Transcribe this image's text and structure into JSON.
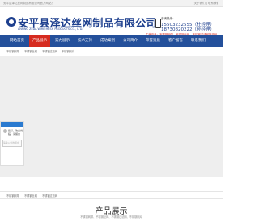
{
  "topbar": {
    "left_text": "安平县泽达丝网制品有限公司官方网站！",
    "right_text": "关于我们 | 联系我们"
  },
  "header": {
    "logo_cn": "安平县泽达丝网制品有限公司",
    "logo_en": "ANPING ZEDA WIRE MESH PRODUCTS CO., LTD.",
    "hotline_label": "咨询热线：",
    "hotline_1": "15503232555（杜经理）",
    "hotline_2": "18730820222（孙经理）",
    "slogan": "主营产品：不锈钢网带、不锈钢丝网、不锈钢过滤网等产品"
  },
  "nav": {
    "items": [
      "网站首页",
      "产品展示",
      "实力展示",
      "技术支持",
      "成功案例",
      "公司简介",
      "荣誉资质",
      "客户留言",
      "联系我们"
    ],
    "active_index": 1
  },
  "subbar": {
    "items": [
      "不锈钢网带",
      "不锈钢丝网",
      "不锈钢过滤网",
      "不锈钢网片"
    ]
  },
  "sidebar": {
    "text": "您好，欢迎光临！请留言",
    "input_placeholder": "请输入您的留言"
  },
  "links_bar": {
    "items": [
      "不锈钢网带",
      "不锈钢丝网",
      "不锈钢过滤网"
    ]
  },
  "section": {
    "title": "产品展示",
    "subtitle": "不锈钢网带、不锈钢丝网、不锈钢过滤网、不锈钢网片"
  },
  "colors": {
    "brand_blue": "#24509b",
    "accent_red": "#d62b20"
  }
}
